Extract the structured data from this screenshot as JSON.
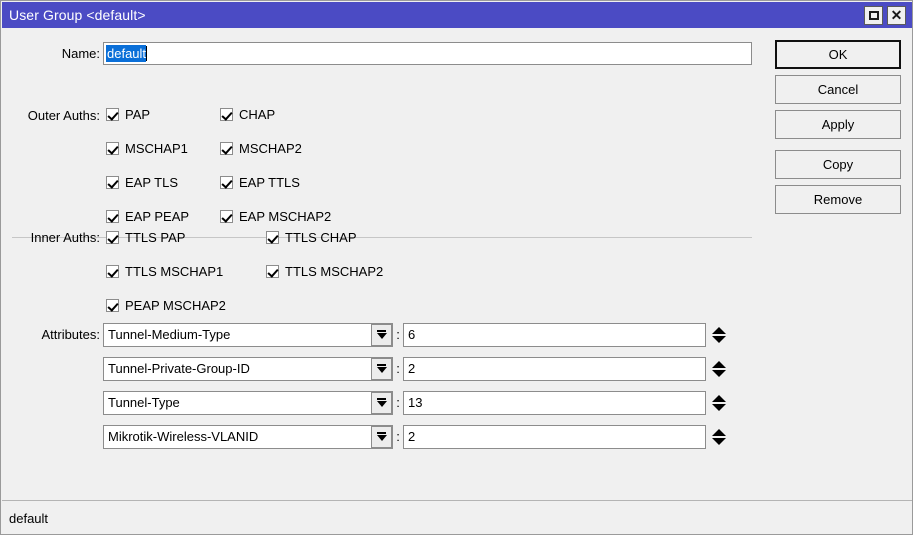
{
  "window": {
    "title": "User Group <default>",
    "titlebar_color": "#4b4bc4",
    "buttons": [
      {
        "name": "maximize",
        "glyph": "square-icon"
      },
      {
        "name": "close",
        "glyph": "close-icon"
      }
    ]
  },
  "form": {
    "name_label": "Name:",
    "name_value": "default",
    "outer_label": "Outer Auths:",
    "inner_label": "Inner Auths:",
    "attributes_label": "Attributes:"
  },
  "outer_auths": [
    {
      "label": "PAP",
      "checked": true
    },
    {
      "label": "CHAP",
      "checked": true
    },
    {
      "label": "MSCHAP1",
      "checked": true
    },
    {
      "label": "MSCHAP2",
      "checked": true
    },
    {
      "label": "EAP TLS",
      "checked": true
    },
    {
      "label": "EAP TTLS",
      "checked": true
    },
    {
      "label": "EAP PEAP",
      "checked": true
    },
    {
      "label": "EAP MSCHAP2",
      "checked": true
    }
  ],
  "inner_auths": [
    {
      "label": "TTLS PAP",
      "checked": true
    },
    {
      "label": "TTLS CHAP",
      "checked": true
    },
    {
      "label": "TTLS MSCHAP1",
      "checked": true
    },
    {
      "label": "TTLS MSCHAP2",
      "checked": true
    },
    {
      "label": "PEAP MSCHAP2",
      "checked": true
    }
  ],
  "attributes": [
    {
      "name": "Tunnel-Medium-Type",
      "separator": ":",
      "value": "6"
    },
    {
      "name": "Tunnel-Private-Group-ID",
      "separator": ":",
      "value": "2"
    },
    {
      "name": "Tunnel-Type",
      "separator": ":",
      "value": "13"
    },
    {
      "name": "Mikrotik-Wireless-VLANID",
      "separator": ":",
      "value": "2"
    }
  ],
  "dialog_buttons": [
    {
      "label": "OK",
      "default": true
    },
    {
      "label": "Cancel",
      "default": false
    },
    {
      "label": "Apply",
      "default": false
    },
    {
      "label": "Copy",
      "default": false
    },
    {
      "label": "Remove",
      "default": false
    }
  ],
  "statusbar": {
    "text": "default"
  }
}
